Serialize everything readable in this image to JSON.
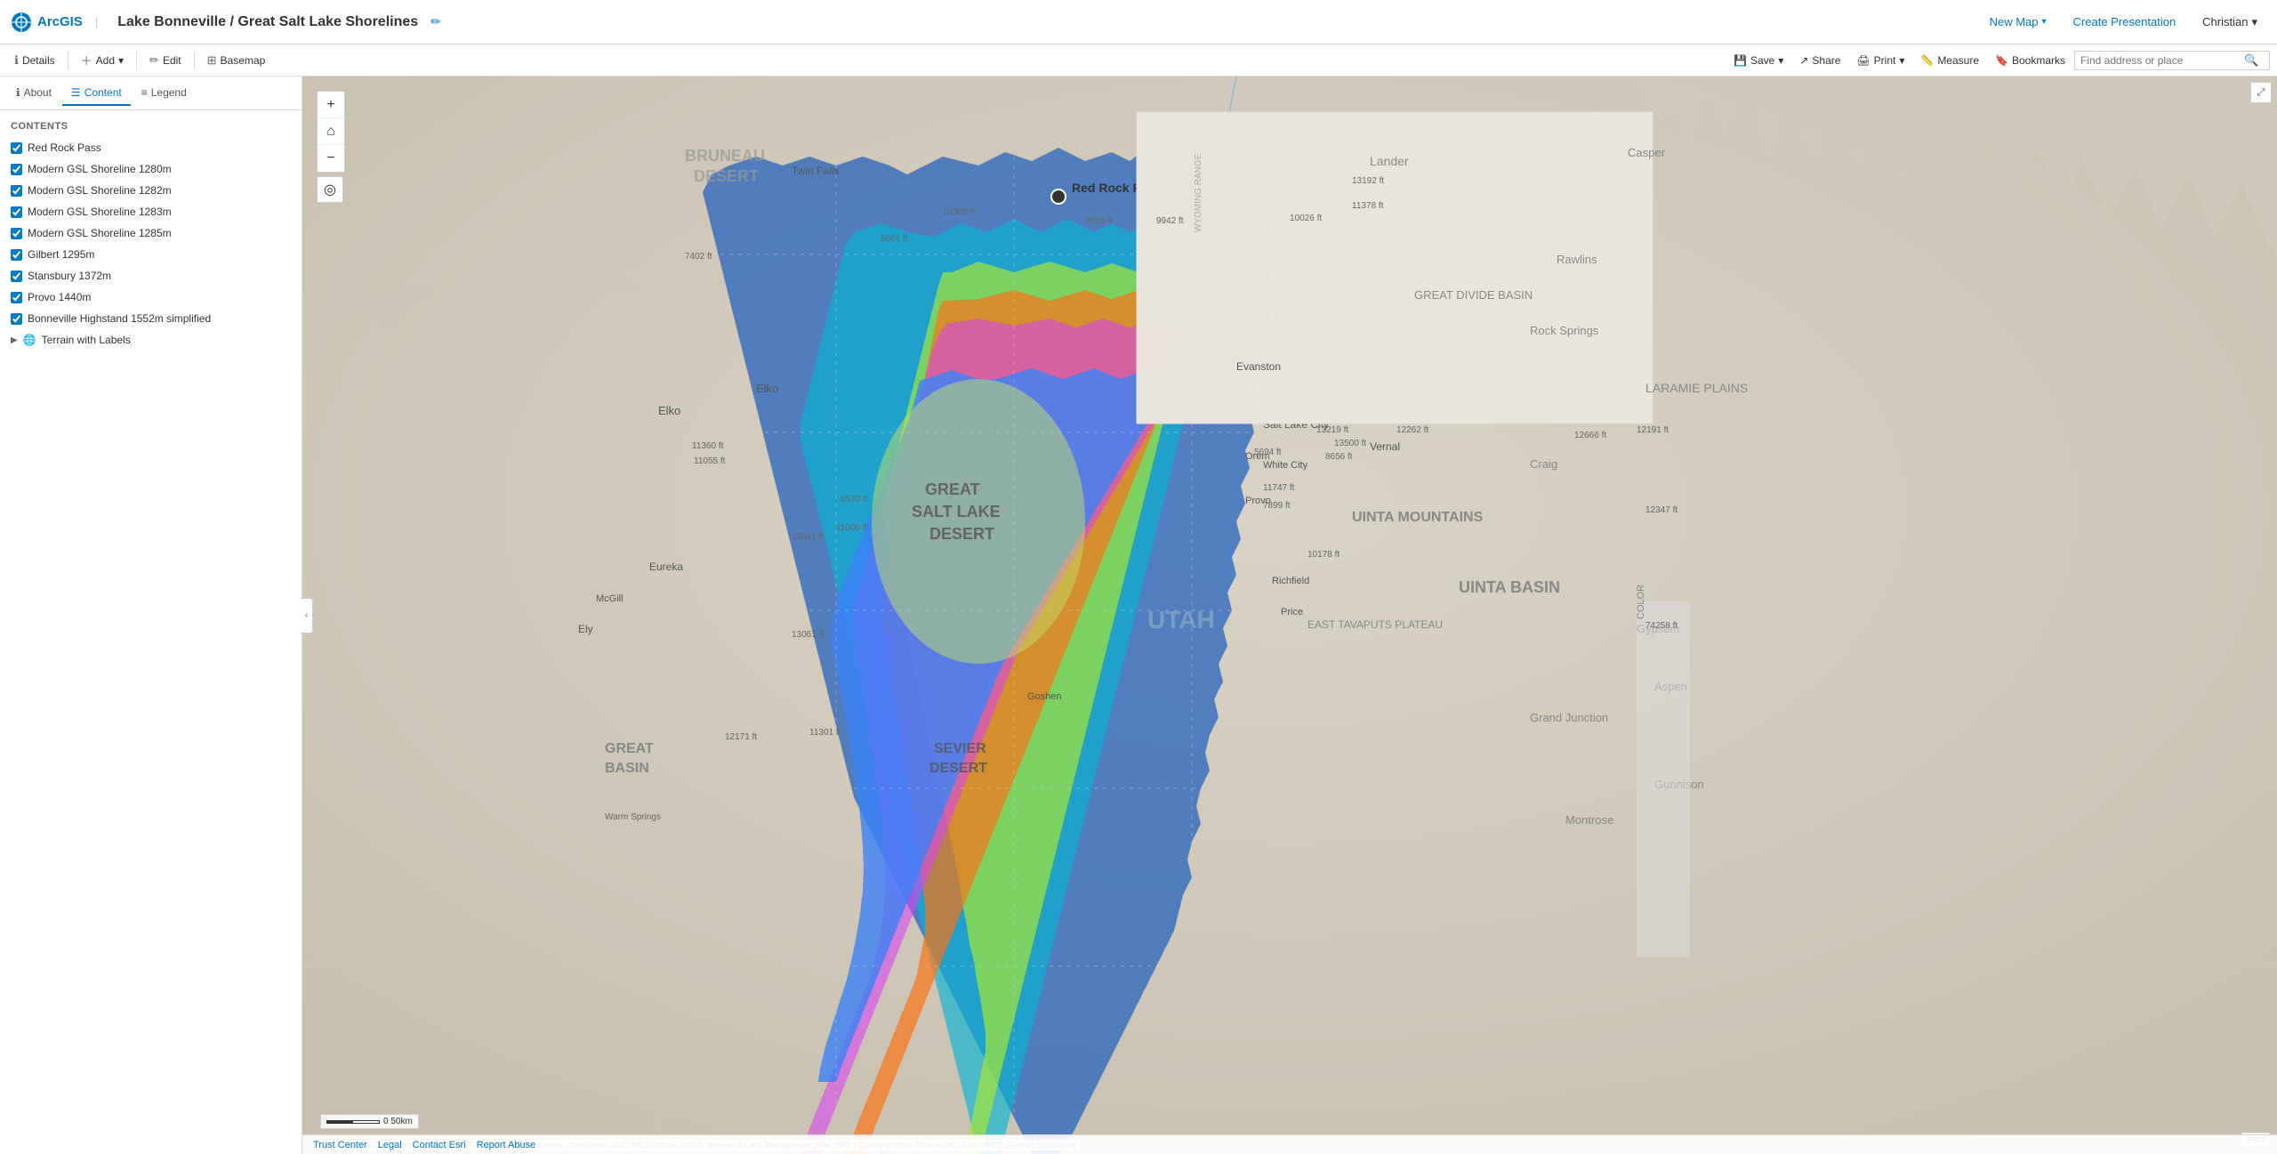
{
  "app": {
    "logo": "ArcGIS",
    "title": "Lake Bonneville / Great Salt Lake Shorelines",
    "edit_icon": "✏"
  },
  "top_nav": {
    "new_map_label": "New Map",
    "create_presentation_label": "Create Presentation",
    "user_label": "Christian",
    "chevron": "▾"
  },
  "toolbar": {
    "details_label": "Details",
    "add_label": "Add",
    "edit_label": "Edit",
    "basemap_label": "Basemap",
    "save_label": "Save",
    "share_label": "Share",
    "print_label": "Print",
    "measure_label": "Measure",
    "bookmarks_label": "Bookmarks",
    "search_placeholder": "Find address or place",
    "search_icon": "🔍"
  },
  "sidebar": {
    "about_tab": "About",
    "content_tab": "Content",
    "legend_tab": "Legend",
    "contents_label": "Contents",
    "layers": [
      {
        "id": 1,
        "name": "Red Rock Pass",
        "checked": true
      },
      {
        "id": 2,
        "name": "Modern GSL Shoreline 1280m",
        "checked": true
      },
      {
        "id": 3,
        "name": "Modern GSL Shoreline 1282m",
        "checked": true
      },
      {
        "id": 4,
        "name": "Modern GSL Shoreline 1283m",
        "checked": true
      },
      {
        "id": 5,
        "name": "Modern GSL Shoreline 1285m",
        "checked": true
      },
      {
        "id": 6,
        "name": "Gilbert 1295m",
        "checked": true
      },
      {
        "id": 7,
        "name": "Stansbury 1372m",
        "checked": true
      },
      {
        "id": 8,
        "name": "Provo 1440m",
        "checked": true
      },
      {
        "id": 9,
        "name": "Bonneville Highstand 1552m simplified",
        "checked": true
      }
    ],
    "basemap_group": "Terrain with Labels"
  },
  "map": {
    "red_rock_pass_label": "Red Rock Pass",
    "scale_bar": "0    50km",
    "esri_label": "esri",
    "attribution": "Esri, USGS | County of Utah, Utah AGRC, Esri, HERE, Garmin, SafeGraph, FAO, METI/NASA, USGS, Bureau of Land Management, EPA, NPS | County of Utah, Utah AGRC, Esri, HERE, Garmin, SafeGraph",
    "zoom_in": "+",
    "zoom_out": "−",
    "home": "⌂",
    "compass": "◎"
  },
  "footer": {
    "trust_center": "Trust Center",
    "legal": "Legal",
    "contact_esri": "Contact Esri",
    "report_abuse": "Report Abuse"
  },
  "colors": {
    "bonneville": "#2563be",
    "provo": "#06b6d4",
    "stansbury": "#a3e635",
    "gilbert": "#f97316",
    "shoreline_1285": "#d946ef",
    "shoreline_1283": "#8b5cf6",
    "shoreline_1282": "#ec4899",
    "shoreline_1280": "#4ade80",
    "modern_lake": "#7dd3fc",
    "terrain_bg": "#e8e0d0"
  }
}
